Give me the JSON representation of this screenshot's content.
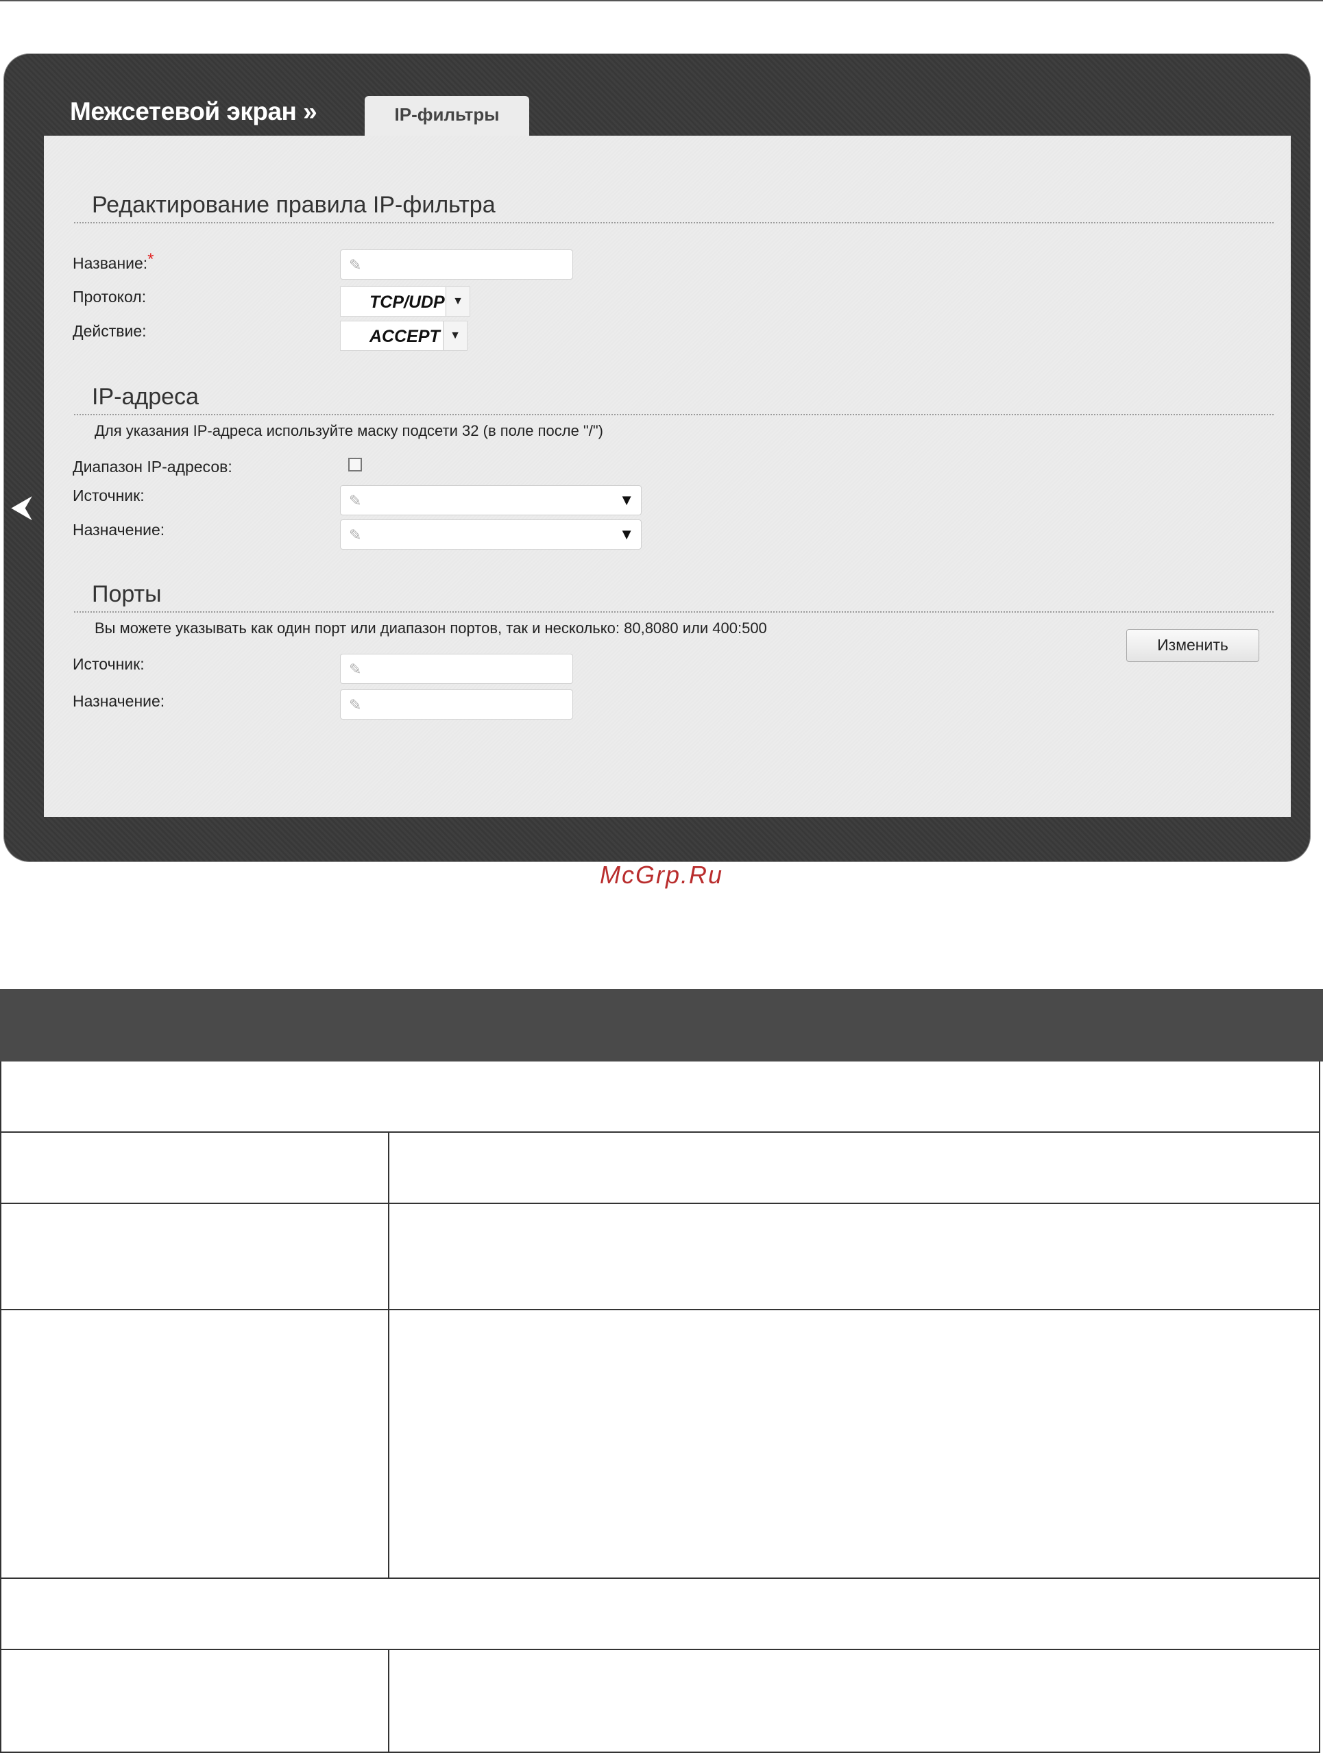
{
  "breadcrumb": "Межсетевой экран »",
  "tab": "IP-фильтры",
  "back_icon": "chevron-left-icon",
  "edit_section": {
    "title": "Редактирование правила IP-фильтра",
    "name_label": "Название:",
    "required_mark": "*",
    "protocol_label": "Протокол:",
    "protocol_value": "TCP/UDP",
    "action_label": "Действие:",
    "action_value": "ACCEPT"
  },
  "ip_section": {
    "title": "IP-адреса",
    "hint": "Для указания IP-адреса используйте маску подсети 32 (в поле после \"/\")",
    "range_label": "Диапазон IP-адресов:",
    "source_label": "Источник:",
    "dest_label": "Назначение:"
  },
  "ports_section": {
    "title": "Порты",
    "hint": "Вы можете указывать как один порт или диапазон портов, так и несколько: 80,8080 или 400:500",
    "source_label": "Источник:",
    "dest_label": "Назначение:"
  },
  "change_button": "Изменить",
  "watermark": "McGrp.Ru"
}
